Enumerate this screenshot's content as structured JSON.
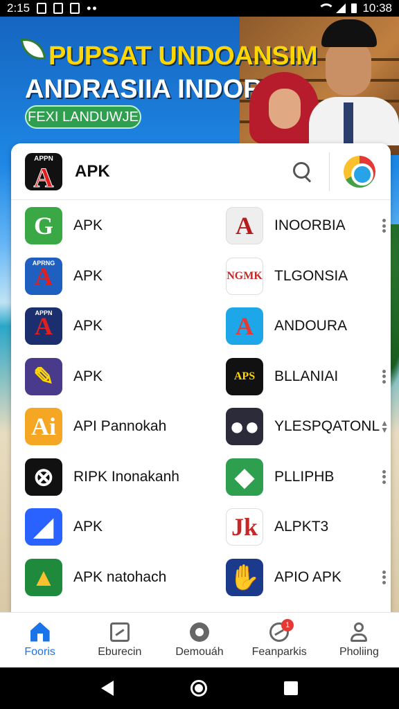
{
  "status_bar": {
    "time_left": "2:15",
    "time_right": "10:38",
    "dots": "••"
  },
  "promo": {
    "title": "PUPSAT UNDOANSIM",
    "subtitle": "ANDRASIIA INDORAN",
    "pill": "FEXI LANDUWJE"
  },
  "header": {
    "logo_caption": "APPN",
    "logo_letter": "A",
    "title": "APK"
  },
  "apps_left": [
    {
      "label": "APK",
      "icon_bg": "#39a845",
      "icon_fg": "#ffffff",
      "glyph": "G",
      "mini": ""
    },
    {
      "label": "APK",
      "icon_bg": "#1e5fbf",
      "icon_fg": "#e02020",
      "glyph": "A",
      "mini": "APRNG"
    },
    {
      "label": "APK",
      "icon_bg": "#1b2f6e",
      "icon_fg": "#e02020",
      "glyph": "A",
      "mini": "APPN"
    },
    {
      "label": "APK",
      "icon_bg": "#4a3a8c",
      "icon_fg": "#ffd600",
      "glyph": "✎",
      "mini": ""
    },
    {
      "label": "API Pannokah",
      "icon_bg": "#f5a623",
      "icon_fg": "#ffffff",
      "glyph": "Ai",
      "mini": ""
    },
    {
      "label": "RIPK Inonakanh",
      "icon_bg": "#111111",
      "icon_fg": "#ffffff",
      "glyph": "⊗",
      "mini": ""
    },
    {
      "label": "APK",
      "icon_bg": "#2962ff",
      "icon_fg": "#ffffff",
      "glyph": "◢",
      "mini": ""
    },
    {
      "label": "APK natohach",
      "icon_bg": "#1f8a3c",
      "icon_fg": "#fbc02d",
      "glyph": "▲",
      "mini": ""
    }
  ],
  "apps_right": [
    {
      "label": "INOORBIA",
      "icon_bg": "#eeeeee",
      "icon_fg": "#b71c1c",
      "glyph": "A",
      "mini": "",
      "control": "more"
    },
    {
      "label": "TLGONSIA",
      "icon_bg": "#ffffff",
      "icon_fg": "#c62828",
      "glyph": "NGMK",
      "mini": "",
      "control": "none"
    },
    {
      "label": "ANDOURA",
      "icon_bg": "#1ea7e8",
      "icon_fg": "#e53935",
      "glyph": "A",
      "mini": "",
      "control": "none"
    },
    {
      "label": "BLLANIAI",
      "icon_bg": "#111111",
      "icon_fg": "#ffd600",
      "glyph": "APS",
      "mini": "",
      "control": "more"
    },
    {
      "label": "YLESPQATONL",
      "icon_bg": "#2b2b3a",
      "icon_fg": "#ffffff",
      "glyph": "●●",
      "mini": "",
      "control": "sort"
    },
    {
      "label": "PLLIPHB",
      "icon_bg": "#2e9e4f",
      "icon_fg": "#ffffff",
      "glyph": "◆",
      "mini": "",
      "control": "more"
    },
    {
      "label": "ALPKT3",
      "icon_bg": "#ffffff",
      "icon_fg": "#c62828",
      "glyph": "Jk",
      "mini": "",
      "control": "none"
    },
    {
      "label": "APIO APK",
      "icon_bg": "#1b3a8c",
      "icon_fg": "#ffd600",
      "glyph": "✋",
      "mini": "",
      "control": "more"
    }
  ],
  "bottom_nav": [
    {
      "label": "Fooris",
      "icon": "home-icon",
      "active": true
    },
    {
      "label": "Eburecin",
      "icon": "box-icon",
      "active": false
    },
    {
      "label": "Demouáh",
      "icon": "globe-icon",
      "active": false
    },
    {
      "label": "Feanparkis",
      "icon": "featured-icon",
      "active": false,
      "badge": "1"
    },
    {
      "label": "Pholiing",
      "icon": "profile-icon",
      "active": false
    }
  ],
  "colors": {
    "accent": "#1a73e8",
    "promo_title": "#ffd600",
    "promo_pill": "#2e9e4f"
  }
}
